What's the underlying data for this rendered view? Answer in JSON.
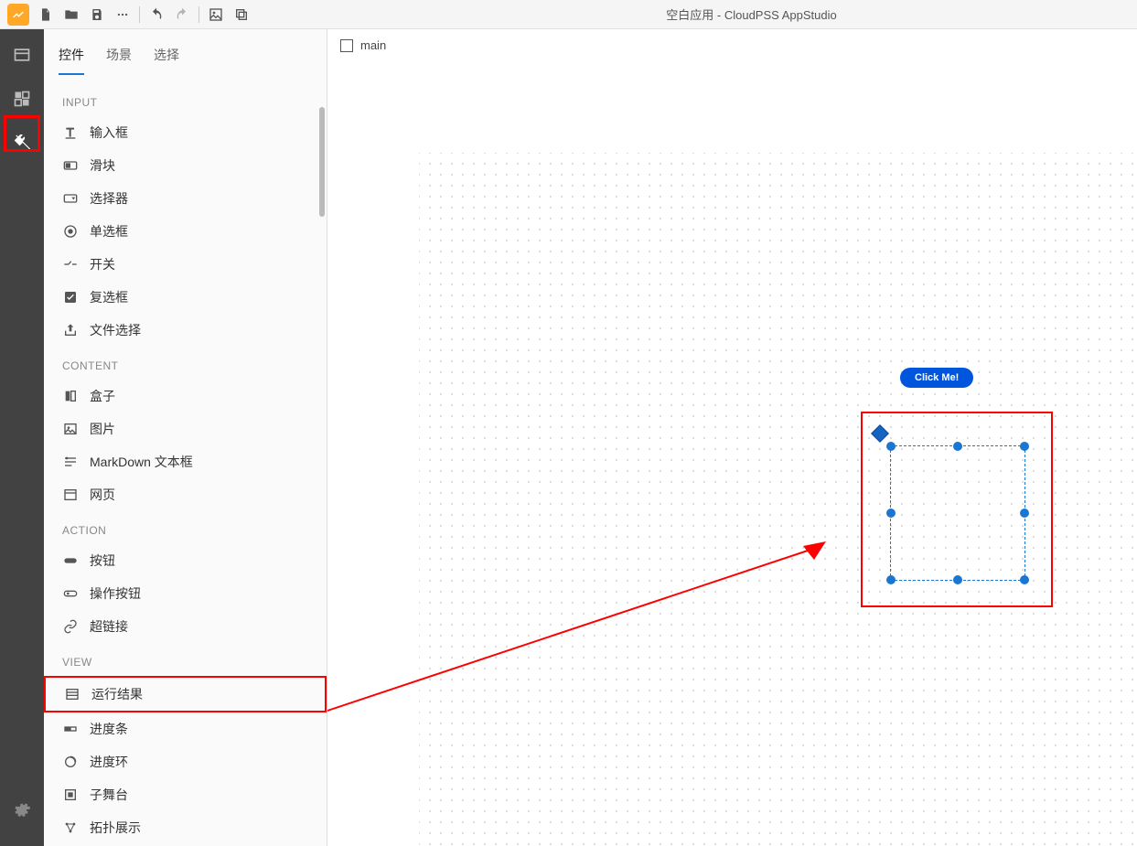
{
  "app": {
    "title": "空白应用 - CloudPSS AppStudio"
  },
  "tabs": {
    "controls": "控件",
    "scenes": "场景",
    "select": "选择"
  },
  "sections": {
    "input": {
      "header": "INPUT",
      "items": [
        "输入框",
        "滑块",
        "选择器",
        "单选框",
        "开关",
        "复选框",
        "文件选择"
      ]
    },
    "content": {
      "header": "CONTENT",
      "items": [
        "盒子",
        "图片",
        "MarkDown 文本框",
        "网页"
      ]
    },
    "action": {
      "header": "ACTION",
      "items": [
        "按钮",
        "操作按钮",
        "超链接"
      ]
    },
    "view": {
      "header": "VIEW",
      "items": [
        "运行结果",
        "进度条",
        "进度环",
        "子舞台",
        "拓扑展示"
      ]
    }
  },
  "canvas": {
    "tab": "main",
    "button_label": "Click Me!"
  }
}
